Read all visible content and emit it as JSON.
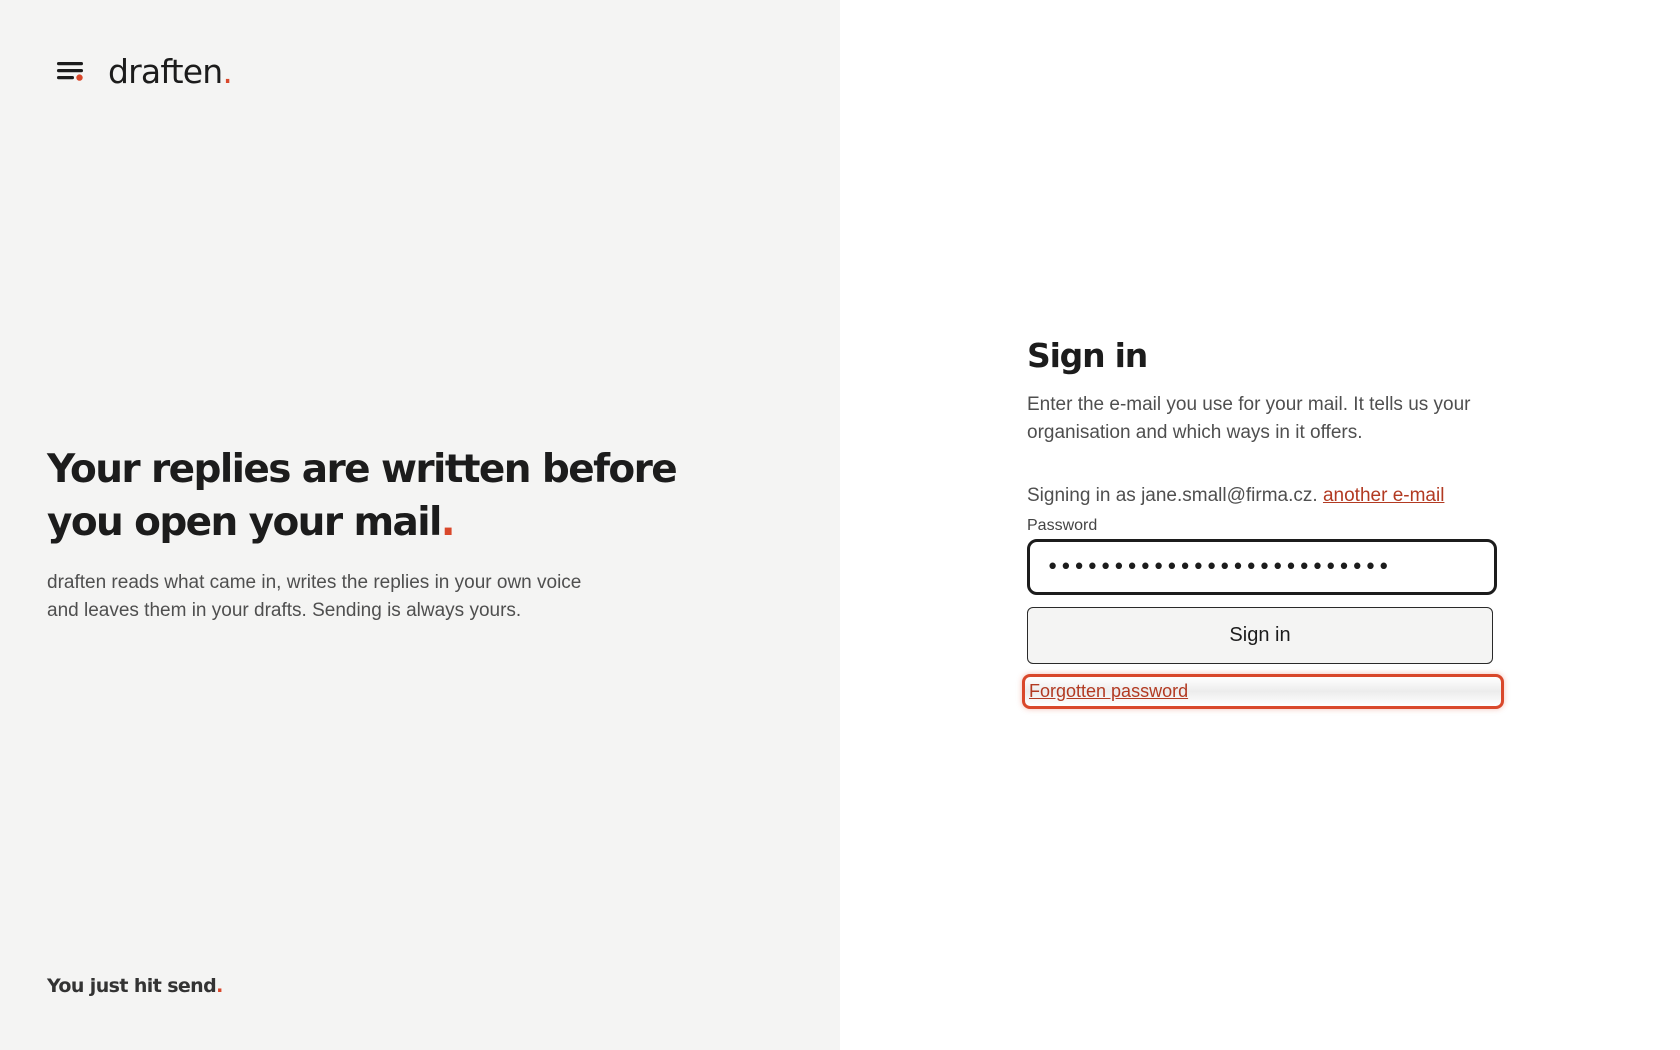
{
  "brand": {
    "name": "draften",
    "dot": "."
  },
  "hero": {
    "title_line1": "Your replies are written before",
    "title_line2": "you open your mail",
    "title_dot": ".",
    "subtitle_line1": "draften reads what came in, writes the replies in your own voice",
    "subtitle_line2": "and leaves them in your drafts. Sending is always yours."
  },
  "footer": {
    "tagline": "You just hit send",
    "dot": "."
  },
  "signin": {
    "title": "Sign in",
    "description_line1": "Enter the e-mail you use for your mail. It tells us your",
    "description_line2": "organisation and which ways in it offers.",
    "signing_as_text": "Signing in as jane.small@firma.cz.",
    "another_email_link": "another e-mail",
    "password_label": "Password",
    "password_value": "••••••••••••••••••••••••••",
    "submit_label": "Sign in",
    "forgot_link": "Forgotten password"
  },
  "colors": {
    "accent": "#d9482b",
    "link": "#b23a22",
    "left_bg": "#f4f4f3",
    "text": "#1c1c1c"
  },
  "icons": {
    "brand_icon": "menu-lines-with-dot-icon"
  }
}
